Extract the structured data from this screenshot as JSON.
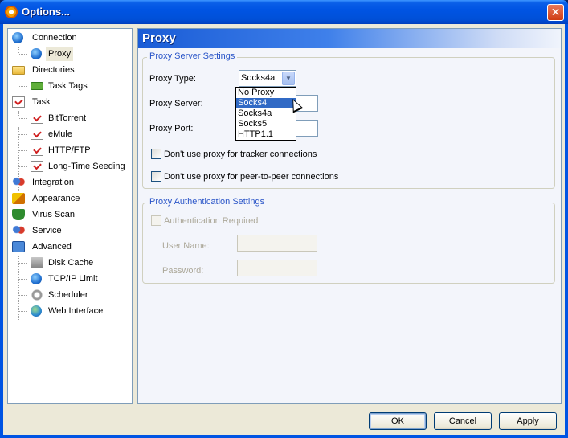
{
  "window": {
    "title": "Options...",
    "close_glyph": "✕"
  },
  "sidebar": {
    "items": [
      {
        "label": "Connection",
        "icon": "globe-network-icon"
      },
      {
        "label": "Proxy",
        "icon": "globe-computer-icon",
        "selected": true
      },
      {
        "label": "Directories",
        "icon": "folder-icon"
      },
      {
        "label": "Task Tags",
        "icon": "tag-icon"
      },
      {
        "label": "Task",
        "icon": "task-check-icon"
      },
      {
        "label": "BitTorrent",
        "icon": "task-check-icon"
      },
      {
        "label": "eMule",
        "icon": "task-check-icon"
      },
      {
        "label": "HTTP/FTP",
        "icon": "task-check-icon"
      },
      {
        "label": "Long-Time Seeding",
        "icon": "task-check-icon"
      },
      {
        "label": "Integration",
        "icon": "people-icon"
      },
      {
        "label": "Appearance",
        "icon": "paintbrush-icon"
      },
      {
        "label": "Virus Scan",
        "icon": "shield-icon"
      },
      {
        "label": "Service",
        "icon": "people-icon"
      },
      {
        "label": "Advanced",
        "icon": "advanced-settings-icon"
      },
      {
        "label": "Disk Cache",
        "icon": "disk-icon"
      },
      {
        "label": "TCP/IP Limit",
        "icon": "globe-network-icon"
      },
      {
        "label": "Scheduler",
        "icon": "clock-icon"
      },
      {
        "label": "Web Interface",
        "icon": "globe-icon"
      }
    ]
  },
  "panel": {
    "title": "Proxy",
    "server_settings": {
      "group_title": "Proxy Server Settings",
      "proxy_type_label": "Proxy Type:",
      "proxy_type_value": "Socks4a",
      "proxy_type_options": [
        "No Proxy",
        "Socks4",
        "Socks4a",
        "Socks5",
        "HTTP1.1"
      ],
      "highlighted_option": "Socks4",
      "proxy_server_label": "Proxy Server:",
      "proxy_server_value": "",
      "proxy_port_label": "Proxy Port:",
      "proxy_port_value": "",
      "no_proxy_tracker_label": "Don't use proxy for tracker connections",
      "no_proxy_tracker_checked": false,
      "no_proxy_p2p_label": "Don't use proxy for peer-to-peer connections",
      "no_proxy_p2p_checked": false
    },
    "auth_settings": {
      "group_title": "Proxy Authentication Settings",
      "auth_required_label": "Authentication Required",
      "auth_required_checked": false,
      "username_label": "User Name:",
      "username_value": "",
      "password_label": "Password:",
      "password_value": ""
    }
  },
  "footer": {
    "ok_label": "OK",
    "cancel_label": "Cancel",
    "apply_label": "Apply"
  }
}
